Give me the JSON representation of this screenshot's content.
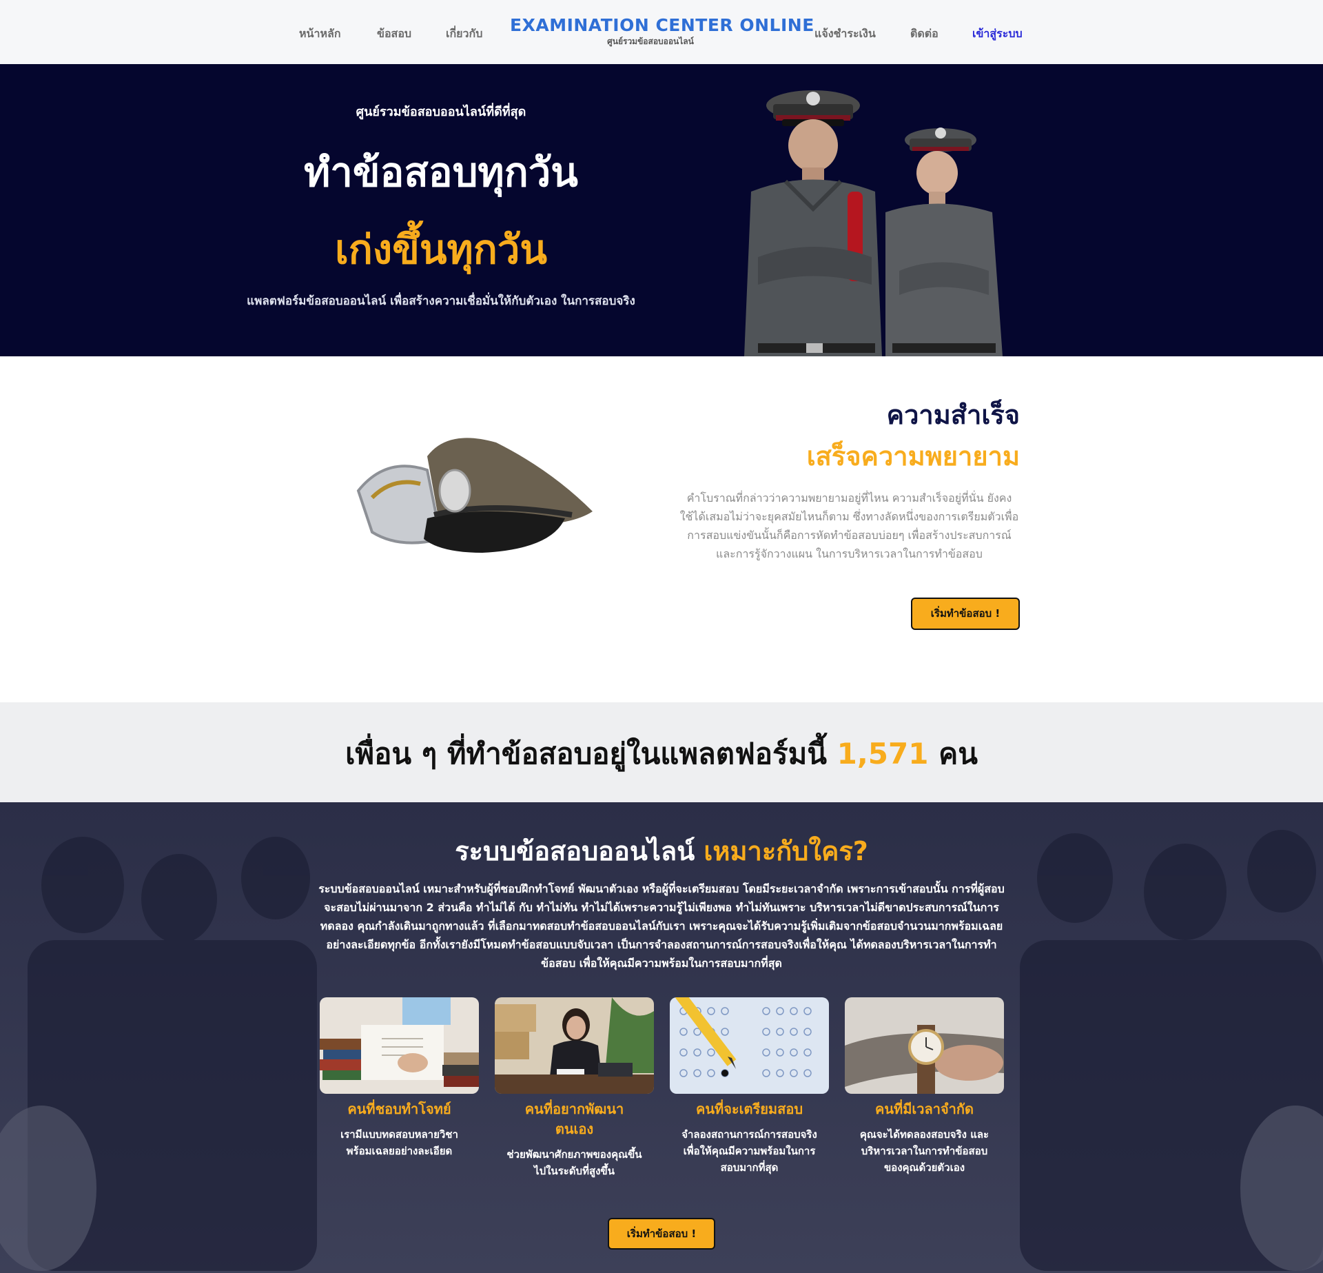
{
  "nav": {
    "home": "หน้าหลัก",
    "exams": "ข้อสอบ",
    "about": "เกี่ยวกับ",
    "brand_title": "EXAMINATION CENTER ONLINE",
    "brand_sub": "ศูนย์รวมข้อสอบออนไลน์",
    "payment": "แจ้งชำระเงิน",
    "contact": "ติดต่อ",
    "login": "เข้าสู่ระบบ"
  },
  "hero": {
    "kicker": "ศูนย์รวมข้อสอบออนไลน์ที่ดีที่สุด",
    "line1": "ทำข้อสอบทุกวัน",
    "line2": "เก่งขึ้นทุกวัน",
    "desc": "แพลตฟอร์มข้อสอบออนไลน์ เพื่อสร้างความเชื่อมั่นให้กับตัวเอง ในการสอบจริง"
  },
  "success": {
    "title1": "ความสำเร็จ",
    "title2": "เสร็จความพยายาม",
    "body": "คำโบราณที่กล่าวว่าความพยายามอยู่ที่ไหน ความสำเร็จอยู่ที่นั่น ยังคงใช้ได้เสมอไม่ว่าจะยุคสมัยไหนก็ตาม ซึ่งทางลัดหนึ่งของการเตรียมตัวเพื่อการสอบแข่งขันนั้นก็คือการหัดทำข้อสอบบ่อยๆ เพื่อสร้างประสบการณ์และการรู้จักวางแผน ในการบริหารเวลาในการทำข้อสอบ",
    "button": "เริ่มทำข้อสอบ !"
  },
  "counter": {
    "prefix": "เพื่อน ๆ ที่ทำข้อสอบอยู่ในแพลตฟอร์มนี้ ",
    "number": "1,571",
    "suffix": " คน"
  },
  "who": {
    "title_main": "ระบบข้อสอบออนไลน์ ",
    "title_accent": "เหมาะกับใคร?",
    "body": "ระบบข้อสอบออนไลน์ เหมาะสำหรับผู้ที่ชอบฝึกทำโจทย์ พัฒนาตัวเอง หรือผู้ที่จะเตรียมสอบ โดยมีระยะเวลาจำกัด เพราะการเข้าสอบนั้น การที่ผู้สอบจะสอบไม่ผ่านมาจาก 2 ส่วนคือ ทำไม่ได้ กับ ทำไม่ทัน ทำไม่ได้เพราะความรู้ไม่เพียงพอ ทำไม่ทันเพราะ บริหารเวลาไม่ดีขาดประสบการณ์ในการทดลอง คุณกำลังเดินมาถูกทางแล้ว ที่เลือกมาทดสอบทำข้อสอบออนไลน์กับเรา เพราะคุณจะได้รับความรู้เพิ่มเติมจากข้อสอบจำนวนมากพร้อมเฉลยอย่างละเอียดทุกข้อ อีกทั้งเรายังมีโหมดทำข้อสอบแบบจับเวลา เป็นการจำลองสถานการณ์การสอบจริงเพื่อให้คุณ ได้ทดลองบริหารเวลาในการทำข้อสอบ เพื่อให้คุณมีความพร้อมในการสอบมากที่สุด",
    "cards": [
      {
        "title": "คนที่ชอบทำโจทย์",
        "desc": "เรามีแบบทดสอบหลายวิชา พร้อมเฉลยอย่างละเอียด"
      },
      {
        "title": "คนที่อยากพัฒนาตนเอง",
        "desc": "ช่วยพัฒนาศักยภาพของคุณขึ้นไปในระดับที่สูงขึ้น"
      },
      {
        "title": "คนที่จะเตรียมสอบ",
        "desc": "จำลองสถานการณ์การสอบจริง เพื่อให้คุณมีความพร้อมในการสอบมากที่สุด"
      },
      {
        "title": "คนที่มีเวลาจำกัด",
        "desc": "คุณจะได้ทดลองสอบจริง และบริหารเวลาในการทำข้อสอบของคุณด้วยตัวเอง"
      }
    ],
    "button": "เริ่มทำข้อสอบ !"
  },
  "colors": {
    "accent": "#f8ac1d",
    "hero_bg": "#05062e",
    "brand": "#2f6fd6",
    "login": "#2a2ad8"
  }
}
